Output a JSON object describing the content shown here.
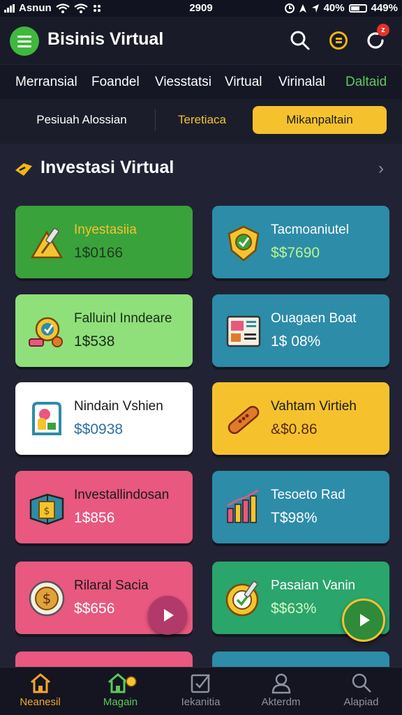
{
  "status_bar": {
    "carrier": "Asnun",
    "time": "2909",
    "battery_text": "40%",
    "extra_text": "449%"
  },
  "app_bar": {
    "title": "Bisinis Virtual"
  },
  "tabs": [
    {
      "label": "Merransial"
    },
    {
      "label": "Foandel"
    },
    {
      "label": "Viesstatsi"
    },
    {
      "label": "Virtual"
    },
    {
      "label": "Virinalal"
    },
    {
      "label": "Daltaid",
      "active": true
    }
  ],
  "segments": [
    {
      "label": "Pesiuah Alossian"
    },
    {
      "label": "Teretiaca"
    },
    {
      "label": "Mikanpaltain",
      "selected": true
    }
  ],
  "section": {
    "title": "Investasi Virtual"
  },
  "cards": [
    {
      "name": "Inyestasiia",
      "value": "1$0166",
      "bg": "#3aa23a",
      "name_color": "#f4c430",
      "value_color": "#1d3a1d",
      "icon": "tools-warning-icon"
    },
    {
      "name": "Tacmoaniutel",
      "value": "$$7690",
      "bg": "#2d8ca8",
      "name_color": "#ffffff",
      "value_color": "#b9f58f",
      "icon": "medal-shield-icon"
    },
    {
      "name": "Falluinl Inndeare",
      "value": "1$538",
      "bg": "#8fe07a",
      "name_color": "#1b2b1b",
      "value_color": "#1b2b1b",
      "icon": "gauge-coins-icon"
    },
    {
      "name": "Ouagaen Boat",
      "value": "1$ 08%",
      "bg": "#2d8ca8",
      "name_color": "#ffffff",
      "value_color": "#ffffff",
      "icon": "report-chart-icon"
    },
    {
      "name": "Nindain Vshien",
      "value": "$$0938",
      "bg": "#ffffff",
      "name_color": "#1a1a1a",
      "value_color": "#2d6fa8",
      "icon": "app-location-icon"
    },
    {
      "name": "Vahtam Virtieh",
      "value": "&$0.86",
      "bg": "#f5c22e",
      "name_color": "#1a1a1a",
      "value_color": "#5a2a0a",
      "icon": "bandage-icon"
    },
    {
      "name": "Investallindosan",
      "value": "1$856",
      "bg": "#e8587f",
      "name_color": "#1a1a1a",
      "value_color": "#ffffff",
      "icon": "cash-box-icon"
    },
    {
      "name": "Tesoeto Rad",
      "value": "T$98%",
      "bg": "#2d8ca8",
      "name_color": "#ffffff",
      "value_color": "#ffffff",
      "icon": "bar-chart-icon"
    },
    {
      "name": "Rilaral Sacia",
      "value": "$$656",
      "bg": "#e8587f",
      "name_color": "#1a1a1a",
      "value_color": "#ffffff",
      "icon": "dollar-coin-icon"
    },
    {
      "name": "Pasaian Vanin",
      "value": "$$63%",
      "bg": "#2aa56b",
      "name_color": "#ffffff",
      "value_color": "#d4f7c4",
      "icon": "target-pen-icon"
    }
  ],
  "bottom_nav": [
    {
      "label": "Neanesil",
      "icon": "home-icon",
      "active": true
    },
    {
      "label": "Magain",
      "icon": "home-coin-icon",
      "green": true
    },
    {
      "label": "Iekanitia",
      "icon": "checkbox-icon"
    },
    {
      "label": "Akterdm",
      "icon": "user-icon"
    },
    {
      "label": "Alapiad",
      "icon": "search-icon"
    }
  ],
  "colors": {
    "accent_green": "#3fb83f",
    "accent_yellow": "#f5c22e",
    "background": "#1b1d2a"
  }
}
